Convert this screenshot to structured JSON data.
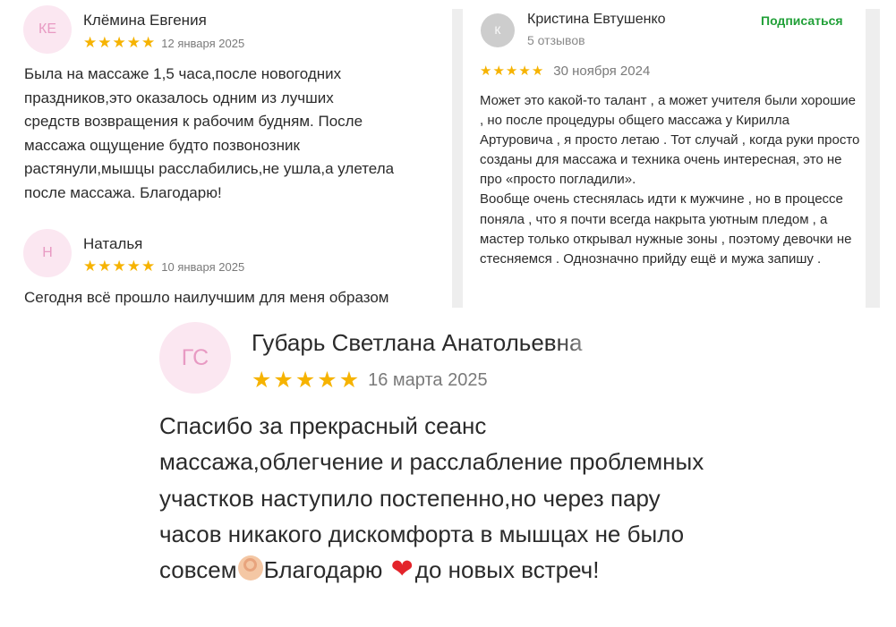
{
  "left_reviews": [
    {
      "initials": "КЕ",
      "name": "Клёмина Евгения",
      "rating": 5,
      "date": "12 января 2025",
      "text": "Была на массаже 1,5 часа,после новогодних\nпраздников,это оказалось одним из лучших\nсредств возвращения к рабочим будням. После\nмассажа ощущение будто позвонозник\nрастянули,мышцы расслабились,не ушла,а улетела\nпосле массажа. Благодарю!"
    },
    {
      "initials": "Н",
      "name": "Наталья",
      "rating": 5,
      "date": "10 января 2025",
      "text": "Сегодня всё прошло наилучшим для меня образом"
    }
  ],
  "right_review": {
    "initials": "К",
    "name": "Кристина Евтушенко",
    "reviews_count": "5 отзывов",
    "subscribe_label": "Подписаться",
    "rating": 5,
    "date": "30 ноября 2024",
    "text_paragraphs": [
      "Может это какой-то талант , а может учителя были хорошие , но после процедуры общего массажа у Кирилла Артуровича , я просто летаю . Тот случай , когда руки просто созданы для массажа и техника очень интересная, это не про «просто погладили».",
      "Вообще очень стеснялась идти к мужчине , но в процессе поняла , что я почти всегда накрыта уютным пледом , а мастер только открывал нужные зоны , поэтому девочки не стесняемся . Однозначно прийду ещё и мужа запишу ."
    ]
  },
  "featured_review": {
    "initials": "ГС",
    "name": "Губарь Светлана Анатольевна",
    "rating": 5,
    "date": "16 марта 2025",
    "text_main": "Спасибо за прекрасный сеанс\nмассажа,облегчение и расслабление проблемных\nучастков наступило постепенно,но через пару\nчасов никакого дискомфорта в мышцах не было\nсовсем",
    "text_mid": "Благодарю ",
    "text_end": "до новых встреч!"
  },
  "colors": {
    "star": "#f6b300",
    "avatar_bg": "#fbe7f1",
    "avatar_fg": "#e89ac3",
    "subscribe": "#21a038"
  },
  "icons": {
    "star": "star-icon",
    "ok_hand": "ok-hand-emoji",
    "heart": "red-heart-emoji"
  }
}
